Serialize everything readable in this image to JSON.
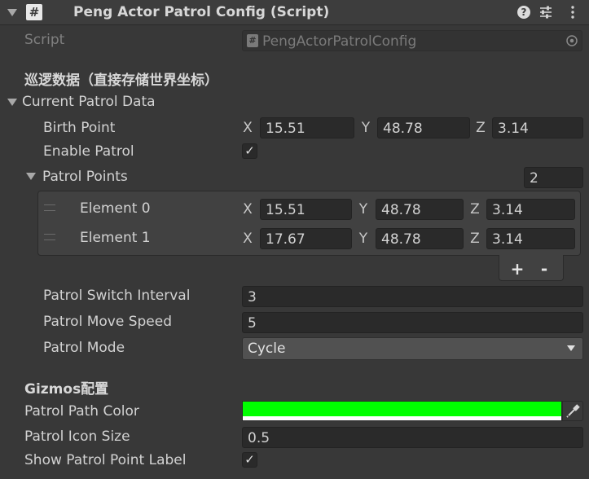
{
  "header": {
    "title": "Peng Actor Patrol Config (Script)",
    "script_icon": "hash-icon",
    "help_icon": "question-circle-icon",
    "preset_icon": "sliders-icon",
    "menu_icon": "kebab-menu-icon"
  },
  "script_row": {
    "label": "Script",
    "value": "PengActorPatrolConfig"
  },
  "patrol_section": {
    "header": "巡逻数据（直接存储世界坐标）",
    "current_label": "Current Patrol Data",
    "birth_point": {
      "label": "Birth Point",
      "x_label": "X",
      "x": "15.51",
      "y_label": "Y",
      "y": "48.78",
      "z_label": "Z",
      "z": "3.14"
    },
    "enable_patrol": {
      "label": "Enable Patrol",
      "checked": true,
      "mark": "✓"
    },
    "patrol_points": {
      "label": "Patrol Points",
      "count": "2",
      "elements": [
        {
          "label": "Element 0",
          "x_label": "X",
          "x": "15.51",
          "y_label": "Y",
          "y": "48.78",
          "z_label": "Z",
          "z": "3.14"
        },
        {
          "label": "Element 1",
          "x_label": "X",
          "x": "17.67",
          "y_label": "Y",
          "y": "48.78",
          "z_label": "Z",
          "z": "3.14"
        }
      ],
      "add_label": "+",
      "remove_label": "-"
    },
    "switch_interval": {
      "label": "Patrol Switch Interval",
      "value": "3"
    },
    "move_speed": {
      "label": "Patrol Move Speed",
      "value": "5"
    },
    "mode": {
      "label": "Patrol Mode",
      "value": "Cycle"
    }
  },
  "gizmos_section": {
    "header": "Gizmos配置",
    "path_color": {
      "label": "Patrol Path Color",
      "color": "#00ff00"
    },
    "icon_size": {
      "label": "Patrol Icon Size",
      "value": "0.5"
    },
    "show_label": {
      "label": "Show Patrol Point Label",
      "checked": true,
      "mark": "✓"
    }
  },
  "colors": {
    "background": "#383838",
    "field": "#2a2a2a",
    "accent_green": "#00ff00"
  }
}
